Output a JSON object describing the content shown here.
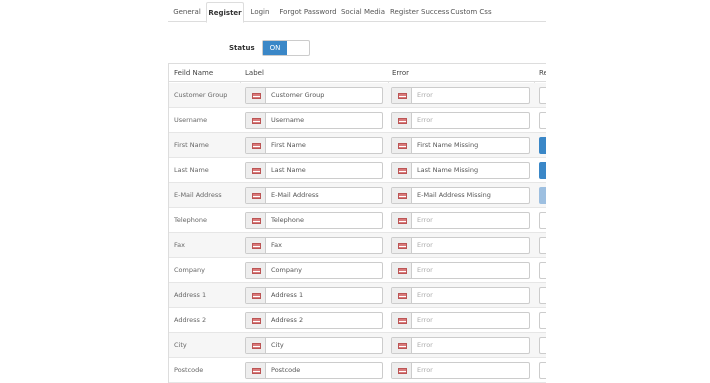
{
  "tabs": [
    "General",
    "Register",
    "Login",
    "Forgot Password",
    "Social Media",
    "Register Success",
    "Custom Css"
  ],
  "active_tab": "Register",
  "status": {
    "label": "Status",
    "toggle": "ON"
  },
  "table": {
    "headers": {
      "field": "Feild Name",
      "label": "Label",
      "error": "Error",
      "required": "Re"
    },
    "rows": [
      {
        "field": "Customer Group",
        "label": "Customer Group",
        "error": "Error",
        "error_placeholder": true,
        "required": "off"
      },
      {
        "field": "Username",
        "label": "Username",
        "error": "Error",
        "error_placeholder": true,
        "required": "off"
      },
      {
        "field": "First Name",
        "label": "First Name",
        "error": "First Name Missing",
        "error_placeholder": false,
        "required": "on"
      },
      {
        "field": "Last Name",
        "label": "Last Name",
        "error": "Last Name Missing",
        "error_placeholder": false,
        "required": "on"
      },
      {
        "field": "E-Mail Address",
        "label": "E-Mail Address",
        "error": "E-Mail Address Missing",
        "error_placeholder": false,
        "required": "light"
      },
      {
        "field": "Telephone",
        "label": "Telephone",
        "error": "Error",
        "error_placeholder": true,
        "required": "off"
      },
      {
        "field": "Fax",
        "label": "Fax",
        "error": "Error",
        "error_placeholder": true,
        "required": "off"
      },
      {
        "field": "Company",
        "label": "Company",
        "error": "Error",
        "error_placeholder": true,
        "required": "off"
      },
      {
        "field": "Address 1",
        "label": "Address 1",
        "error": "Error",
        "error_placeholder": true,
        "required": "off"
      },
      {
        "field": "Address 2",
        "label": "Address 2",
        "error": "Error",
        "error_placeholder": true,
        "required": "off"
      },
      {
        "field": "City",
        "label": "City",
        "error": "Error",
        "error_placeholder": true,
        "required": "off"
      },
      {
        "field": "Postcode",
        "label": "Postcode",
        "error": "Error",
        "error_placeholder": true,
        "required": "off"
      }
    ]
  },
  "icons": {
    "flag": "flag-icon"
  },
  "colors": {
    "toggle_on": "#3a87c7",
    "required_on": "#3a87c7",
    "required_light": "#9dbfe0",
    "row_alt": "#f6f6f6"
  }
}
